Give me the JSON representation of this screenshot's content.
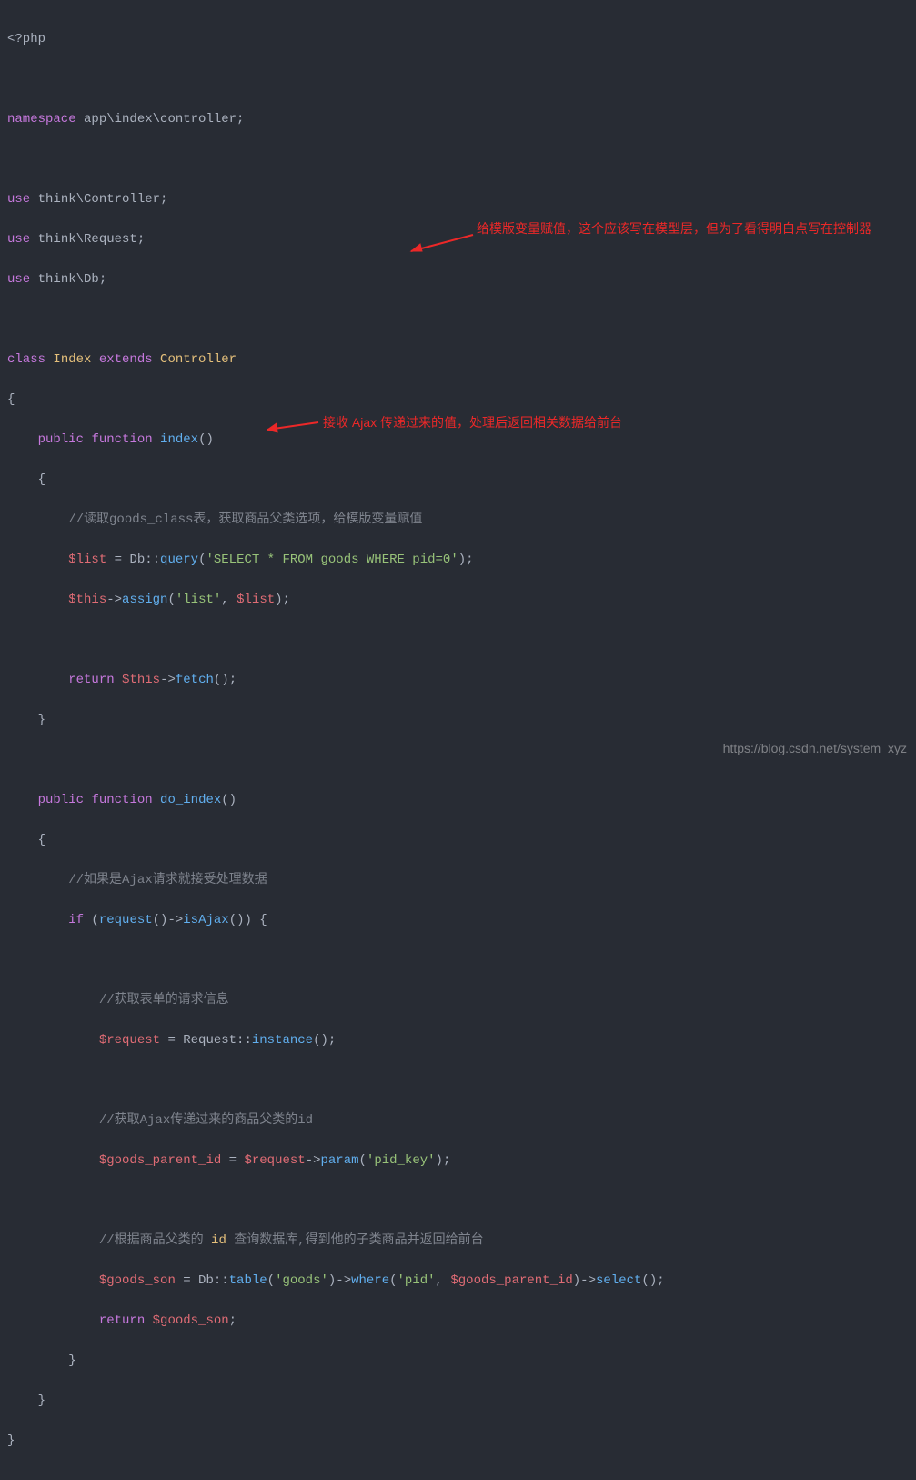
{
  "code": {
    "l1_open": "<?php",
    "l2_ns": "namespace",
    "l2_path": " app\\index\\controller;",
    "l3_use": "use",
    "l3_a": " think\\Controller;",
    "l4_a": " think\\Request;",
    "l5_a": " think\\Db;",
    "l6_class": "class",
    "l6_name": " Index ",
    "l6_ext": "extends",
    "l6_ctrl": " Controller",
    "brace_o": "{",
    "brace_c": "}",
    "pub": "public",
    "func": "function",
    "m1_name": " index",
    "paren": "()",
    "m1_c1": "//读取goods_class表，获取商品父类选项，给模版变量赋值",
    "m1_var_list": "$list",
    "m1_eq": " = Db::",
    "m1_query": "query",
    "m1_paren_o": "(",
    "m1_sql": "'SELECT * FROM goods WHERE pid=0'",
    "m1_paren_c": ");",
    "m1_this": "$this",
    "m1_arrow": "->",
    "m1_assign": "assign",
    "m1_ao": "(",
    "m1_astr": "'list'",
    "m1_com": ", ",
    "m1_alist": "$list",
    "m1_ac": ");",
    "m1_ret": "return",
    "m1_rthis": " $this",
    "m1_rarrow": "->",
    "m1_fetch": "fetch",
    "m1_fc": "();",
    "m2_name": " do_index",
    "m2_c1": "//如果是Ajax请求就接受处理数据",
    "m2_if": "if",
    "m2_ifcond_a": " (",
    "m2_req": "request",
    "m2_reqp": "()->",
    "m2_isajax": "isAjax",
    "m2_isajaxp": "()) {",
    "m2_c2": "//获取表单的请求信息",
    "m2_vreq": "$request",
    "m2_veq": " = Request::",
    "m2_inst": "instance",
    "m2_instp": "();",
    "m2_c3": "//获取Ajax传递过来的商品父类的id",
    "m2_vgpid": "$goods_parent_id",
    "m2_veq2": " = ",
    "m2_vreq2": "$request",
    "m2_arr2": "->",
    "m2_param": "param",
    "m2_po": "(",
    "m2_pkey": "'pid_key'",
    "m2_pc": ");",
    "m2_c4a": "//根据商品父类的 ",
    "m2_c4id": "id",
    "m2_c4b": " 查询数据库,得到他的子类商品并返回给前台",
    "m2_vson": "$goods_son",
    "m2_seq": " = Db::",
    "m2_table": "table",
    "m2_to": "(",
    "m2_goods": "'goods'",
    "m2_tc": ")->",
    "m2_where": "where",
    "m2_wo": "(",
    "m2_pid": "'pid'",
    "m2_wcom": ", ",
    "m2_gpid": "$goods_parent_id",
    "m2_wc": ")->",
    "m2_select": "select",
    "m2_sp": "();",
    "m2_ret": "return",
    "m2_rson": " $goods_son",
    "m2_rsc": ";"
  },
  "annotations": {
    "a1": "给模版变量赋值，这个应该写在模型层，但为了看得明白点写在控制器",
    "a2": "接收 Ajax 传递过来的值，处理后返回相关数据给前台"
  },
  "watermark": "https://blog.csdn.net/system_xyz"
}
